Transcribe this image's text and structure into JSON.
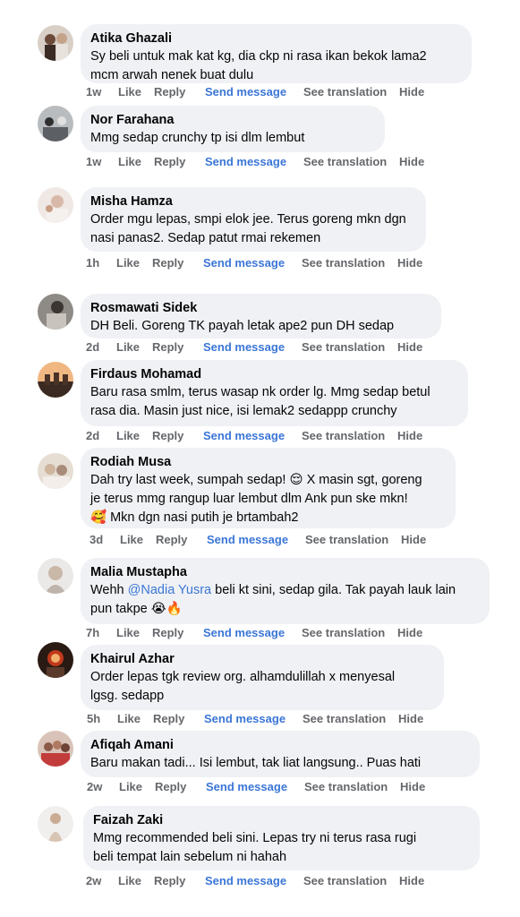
{
  "actions": {
    "like": "Like",
    "reply": "Reply",
    "send_message": "Send message",
    "see_translation": "See translation",
    "hide": "Hide"
  },
  "colors": {
    "bubble": "#eff1f4",
    "link": "#3b76d6",
    "meta": "#65676b"
  },
  "comments": [
    {
      "name": "Atika Ghazali",
      "lines": [
        "Sy beli untuk mak kat kg, dia ckp ni rasa ikan bekok lama2",
        "mcm arwah nenek buat dulu"
      ],
      "time": "1w"
    },
    {
      "name": "Nor Farahana",
      "lines": [
        "Mmg sedap crunchy tp isi dlm lembut"
      ],
      "time": "1w"
    },
    {
      "name": "Misha Hamza",
      "lines": [
        "Order mgu lepas, smpi elok jee. Terus goreng mkn dgn",
        "nasi panas2. Sedap patut rmai rekemen"
      ],
      "time": "1h"
    },
    {
      "name": "Rosmawati Sidek",
      "lines": [
        "DH Beli. Goreng TK payah letak ape2 pun DH sedap"
      ],
      "time": "2d"
    },
    {
      "name": "Firdaus Mohamad",
      "lines": [
        "Baru rasa smlm, terus wasap nk order lg. Mmg sedap betul",
        "rasa dia. Masin just nice, isi lemak2 sedappp crunchy"
      ],
      "time": "2d"
    },
    {
      "name": "Rodiah Musa",
      "lines": [
        "Dah try last week, sumpah sedap! 😌 X masin sgt, goreng",
        "je terus mmg rangup luar lembut dlm Ank pun ske mkn!",
        "🥰 Mkn dgn nasi putih je brtambah2"
      ],
      "time": "3d"
    },
    {
      "name": "Malia Mustapha",
      "line1_pre": "Wehh ",
      "mention": "@Nadia Yusra",
      "line1_post": " beli kt sini, sedap gila. Tak payah lauk lain",
      "lines": [
        "pun takpe 😭🔥"
      ],
      "time": "7h"
    },
    {
      "name": "Khairul Azhar",
      "lines": [
        "Order lepas tgk review org. alhamdulillah x menyesal",
        "lgsg. sedapp"
      ],
      "time": "5h"
    },
    {
      "name": "Afiqah Amani",
      "lines": [
        "Baru makan tadi... Isi lembut, tak liat langsung.. Puas hati"
      ],
      "time": "2w"
    },
    {
      "name": "Faizah Zaki",
      "lines": [
        "Mmg recommended beli sini. Lepas try ni terus rasa rugi",
        "beli tempat lain sebelum ni hahah"
      ],
      "time": "2w"
    }
  ]
}
